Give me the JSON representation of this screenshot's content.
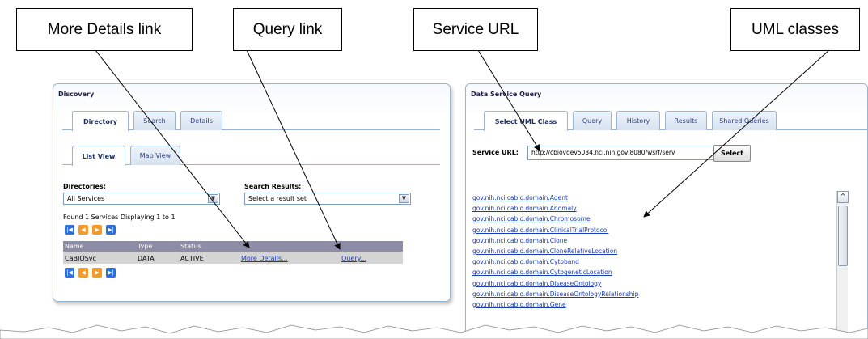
{
  "callouts": {
    "more_details": "More Details link",
    "query": "Query link",
    "service_url": "Service URL",
    "uml_classes": "UML classes"
  },
  "discovery": {
    "title": "Discovery",
    "tabs": [
      "Directory",
      "Search",
      "Details"
    ],
    "subtabs": [
      "List View",
      "Map View"
    ],
    "directories_label": "Directories:",
    "directories_value": "All Services",
    "search_results_label": "Search Results:",
    "search_results_value": "Select a result set",
    "found_text": "Found 1 Services Displaying 1 to 1",
    "columns": [
      "Name",
      "Type",
      "Status"
    ],
    "row": {
      "name": "CaBIOSvc",
      "type": "DATA",
      "status": "ACTIVE",
      "more_details": "More Details...",
      "query": "Query..."
    }
  },
  "data_service_query": {
    "title": "Data Service Query",
    "tabs": [
      "Select UML Class",
      "Query",
      "History",
      "Results",
      "Shared Queries"
    ],
    "service_url_label": "Service URL:",
    "service_url_value": "http://cbiovdev5034.nci.nih.gov:8080/wsrf/serv",
    "select_button": "Select",
    "uml_classes": [
      "gov.nih.nci.cabio.domain.Agent",
      "gov.nih.nci.cabio.domain.Anomaly",
      "gov.nih.nci.cabio.domain.Chromosome",
      "gov.nih.nci.cabio.domain.ClinicalTrialProtocol",
      "gov.nih.nci.cabio.domain.Clone",
      "gov.nih.nci.cabio.domain.CloneRelativeLocation",
      "gov.nih.nci.cabio.domain.Cytoband",
      "gov.nih.nci.cabio.domain.CytogeneticLocation",
      "gov.nih.nci.cabio.domain.DiseaseOntology",
      "gov.nih.nci.cabio.domain.DiseaseOntologyRelationship",
      "gov.nih.nci.cabio.domain.Gene"
    ]
  }
}
